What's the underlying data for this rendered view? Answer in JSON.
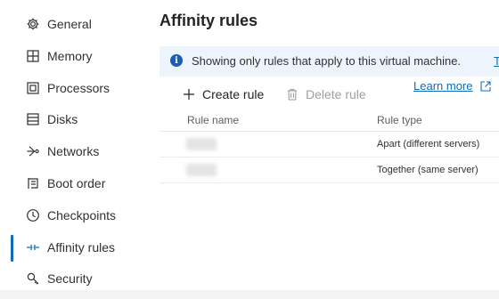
{
  "sidebar": {
    "items": [
      {
        "label": "General",
        "icon": "gear-icon"
      },
      {
        "label": "Memory",
        "icon": "memory-icon"
      },
      {
        "label": "Processors",
        "icon": "processor-icon"
      },
      {
        "label": "Disks",
        "icon": "disks-icon"
      },
      {
        "label": "Networks",
        "icon": "network-icon"
      },
      {
        "label": "Boot order",
        "icon": "boot-order-icon"
      },
      {
        "label": "Checkpoints",
        "icon": "clock-icon"
      },
      {
        "label": "Affinity rules",
        "icon": "affinity-icon",
        "active": true
      },
      {
        "label": "Security",
        "icon": "key-icon"
      }
    ]
  },
  "main": {
    "title": "Affinity rules",
    "info": {
      "text": "Showing only rules that apply to this virtual machine.",
      "link": "To"
    },
    "toolbar": {
      "create_label": "Create rule",
      "delete_label": "Delete rule"
    },
    "learn_more": "Learn more",
    "grid": {
      "columns": [
        "Rule name",
        "Rule type"
      ],
      "rows": [
        {
          "name": "",
          "type": "Apart (different servers)"
        },
        {
          "name": "",
          "type": "Together (same server)"
        }
      ]
    }
  },
  "colors": {
    "accent": "#0f6cbd",
    "info_background": "#eef4fb",
    "disabled_text": "#a19f9d"
  }
}
